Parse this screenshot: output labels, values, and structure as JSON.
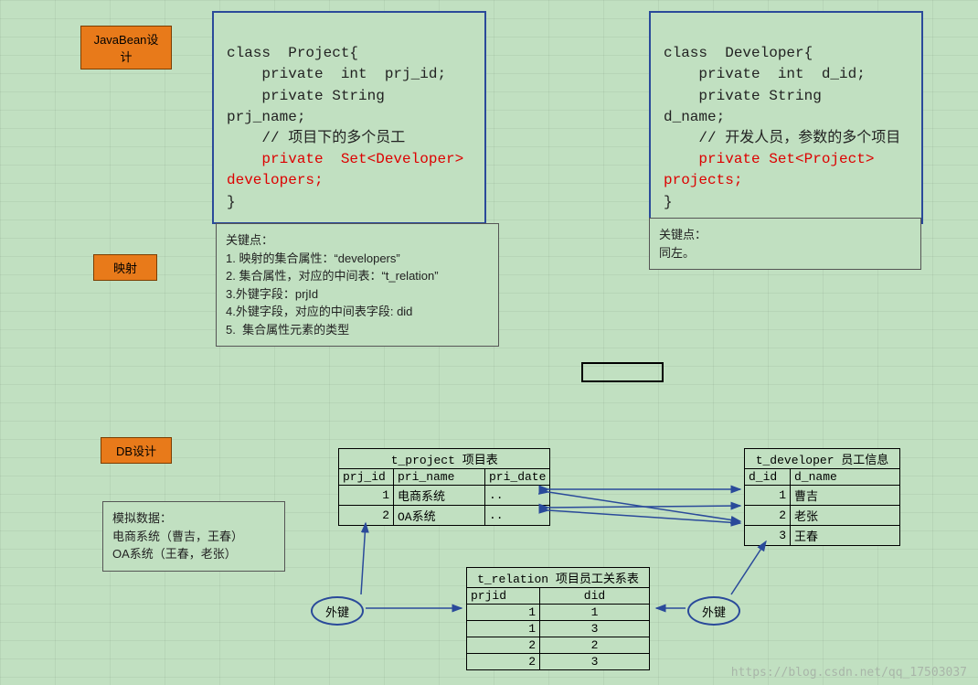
{
  "tags": {
    "javabean": "JavaBean设计",
    "mapping": "映射",
    "db": "DB设计"
  },
  "code_project": {
    "l1": "class  Project{",
    "l2": "    private  int  prj_id;",
    "l3": "    private String  prj_name;",
    "l4": "    // 项目下的多个员工",
    "l5": "    private  Set<Developer> developers;",
    "l6": "}"
  },
  "code_developer": {
    "l1": "class  Developer{",
    "l2": "    private  int  d_id;",
    "l3": "    private String   d_name;",
    "l4": "    // 开发人员，参数的多个项目",
    "l5": "    private Set<Project> projects;",
    "l6": "}"
  },
  "note_left": "关键点：\n1. 映射的集合属性：“developers”\n2. 集合属性，对应的中间表：“t_relation”\n3.外键字段：prjId\n4.外键字段，对应的中间表字段: did\n5.  集合属性元素的类型",
  "note_right": "关键点：\n同左。",
  "mock_note": "模拟数据：\n电商系统（曹吉，王春）\nOA系统（王春，老张）",
  "fk_label": "外键",
  "t_project": {
    "title": "t_project 项目表",
    "cols": [
      "prj_id",
      "pri_name",
      "pri_date"
    ],
    "rows": [
      [
        "1",
        "电商系统",
        ".."
      ],
      [
        "2",
        "OA系统",
        ".."
      ]
    ]
  },
  "t_developer": {
    "title": "t_developer 员工信息",
    "cols": [
      "d_id",
      "d_name"
    ],
    "rows": [
      [
        "1",
        "曹吉"
      ],
      [
        "2",
        "老张"
      ],
      [
        "3",
        "王春"
      ]
    ]
  },
  "t_relation": {
    "title": "t_relation 项目员工关系表",
    "cols": [
      "prjid",
      "did"
    ],
    "rows": [
      [
        "1",
        "1"
      ],
      [
        "1",
        "3"
      ],
      [
        "2",
        "2"
      ],
      [
        "2",
        "3"
      ]
    ]
  },
  "watermark": "https://blog.csdn.net/qq_17503037"
}
